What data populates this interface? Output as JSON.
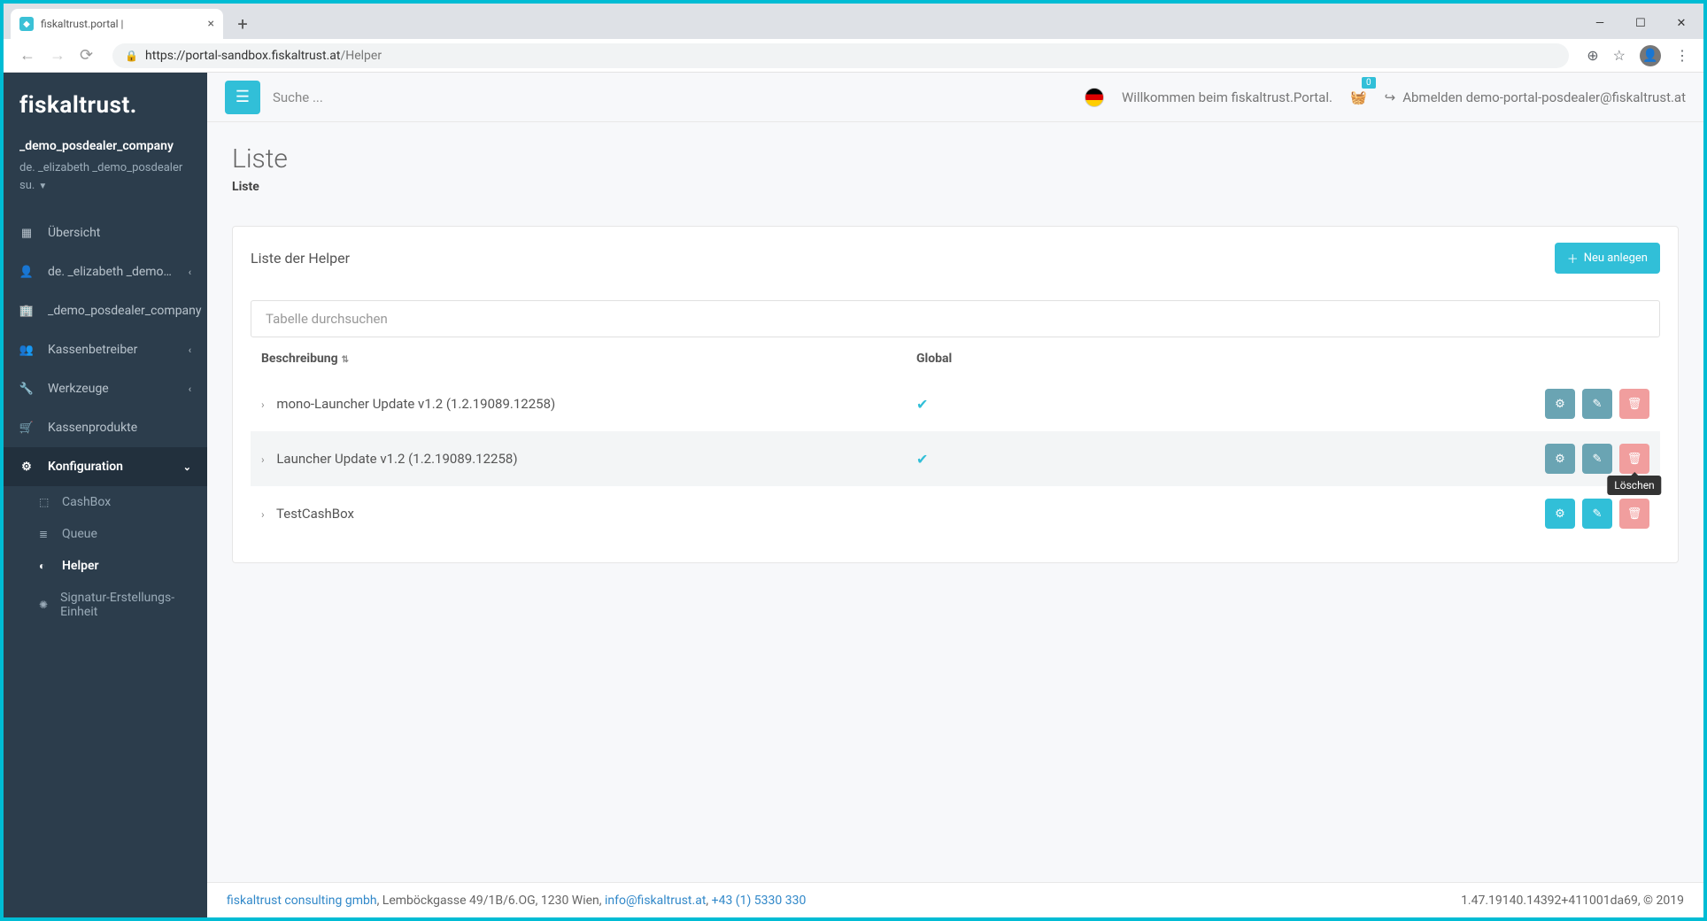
{
  "browser": {
    "tab_title": "fiskaltrust.portal |",
    "url": "https://portal-sandbox.fiskaltrust.at/Helper",
    "url_path_bold": "https://portal-sandbox.fiskaltrust.at",
    "url_path_rest": "/Helper"
  },
  "sidebar": {
    "brand": "fiskaltrust.",
    "org": "_demo_posdealer_company",
    "user": "de. _elizabeth _demo_posdealer su.",
    "items": [
      {
        "icon": "grid",
        "label": "Übersicht",
        "chev": false
      },
      {
        "icon": "user",
        "label": "de. _elizabeth _demo_posdealer su.",
        "chev": true
      },
      {
        "icon": "building",
        "label": "_demo_posdealer_company",
        "chev": true
      },
      {
        "icon": "users",
        "label": "Kassenbetreiber",
        "chev": true
      },
      {
        "icon": "wrench",
        "label": "Werkzeuge",
        "chev": true
      },
      {
        "icon": "cart",
        "label": "Kassenprodukte",
        "chev": false
      }
    ],
    "config_label": "Konfiguration",
    "subs": [
      {
        "icon": "cube",
        "label": "CashBox"
      },
      {
        "icon": "stack",
        "label": "Queue"
      },
      {
        "icon": "adjust",
        "label": "Helper",
        "active": true
      },
      {
        "icon": "cog",
        "label": "Signatur-Erstellungs-Einheit"
      }
    ]
  },
  "topbar": {
    "search_placeholder": "Suche ...",
    "welcome": "Willkommen beim fiskaltrust.Portal.",
    "cart_count": "0",
    "logout": "Abmelden demo-portal-posdealer@fiskaltrust.at"
  },
  "page": {
    "title": "Liste",
    "breadcrumb": "Liste",
    "card_title": "Liste der Helper",
    "new_button": "Neu anlegen",
    "table_search_placeholder": "Tabelle durchsuchen",
    "col_desc": "Beschreibung",
    "col_global": "Global",
    "rows": [
      {
        "desc": "mono-Launcher Update v1.2 (1.2.19089.12258)",
        "global": true,
        "bright": false
      },
      {
        "desc": "Launcher Update v1.2 (1.2.19089.12258)",
        "global": true,
        "bright": false,
        "tooltip": "Löschen"
      },
      {
        "desc": "TestCashBox",
        "global": false,
        "bright": true
      }
    ],
    "tooltip_delete": "Löschen"
  },
  "footer": {
    "company": "fiskaltrust consulting gmbh",
    "address": ", Lemböckgasse 49/1B/6.OG, 1230 Wien, ",
    "email": "info@fiskaltrust.at",
    "sep": ", ",
    "phone": "+43 (1) 5330 330",
    "version": "1.47.19140.14392+411001da69, © 2019"
  }
}
